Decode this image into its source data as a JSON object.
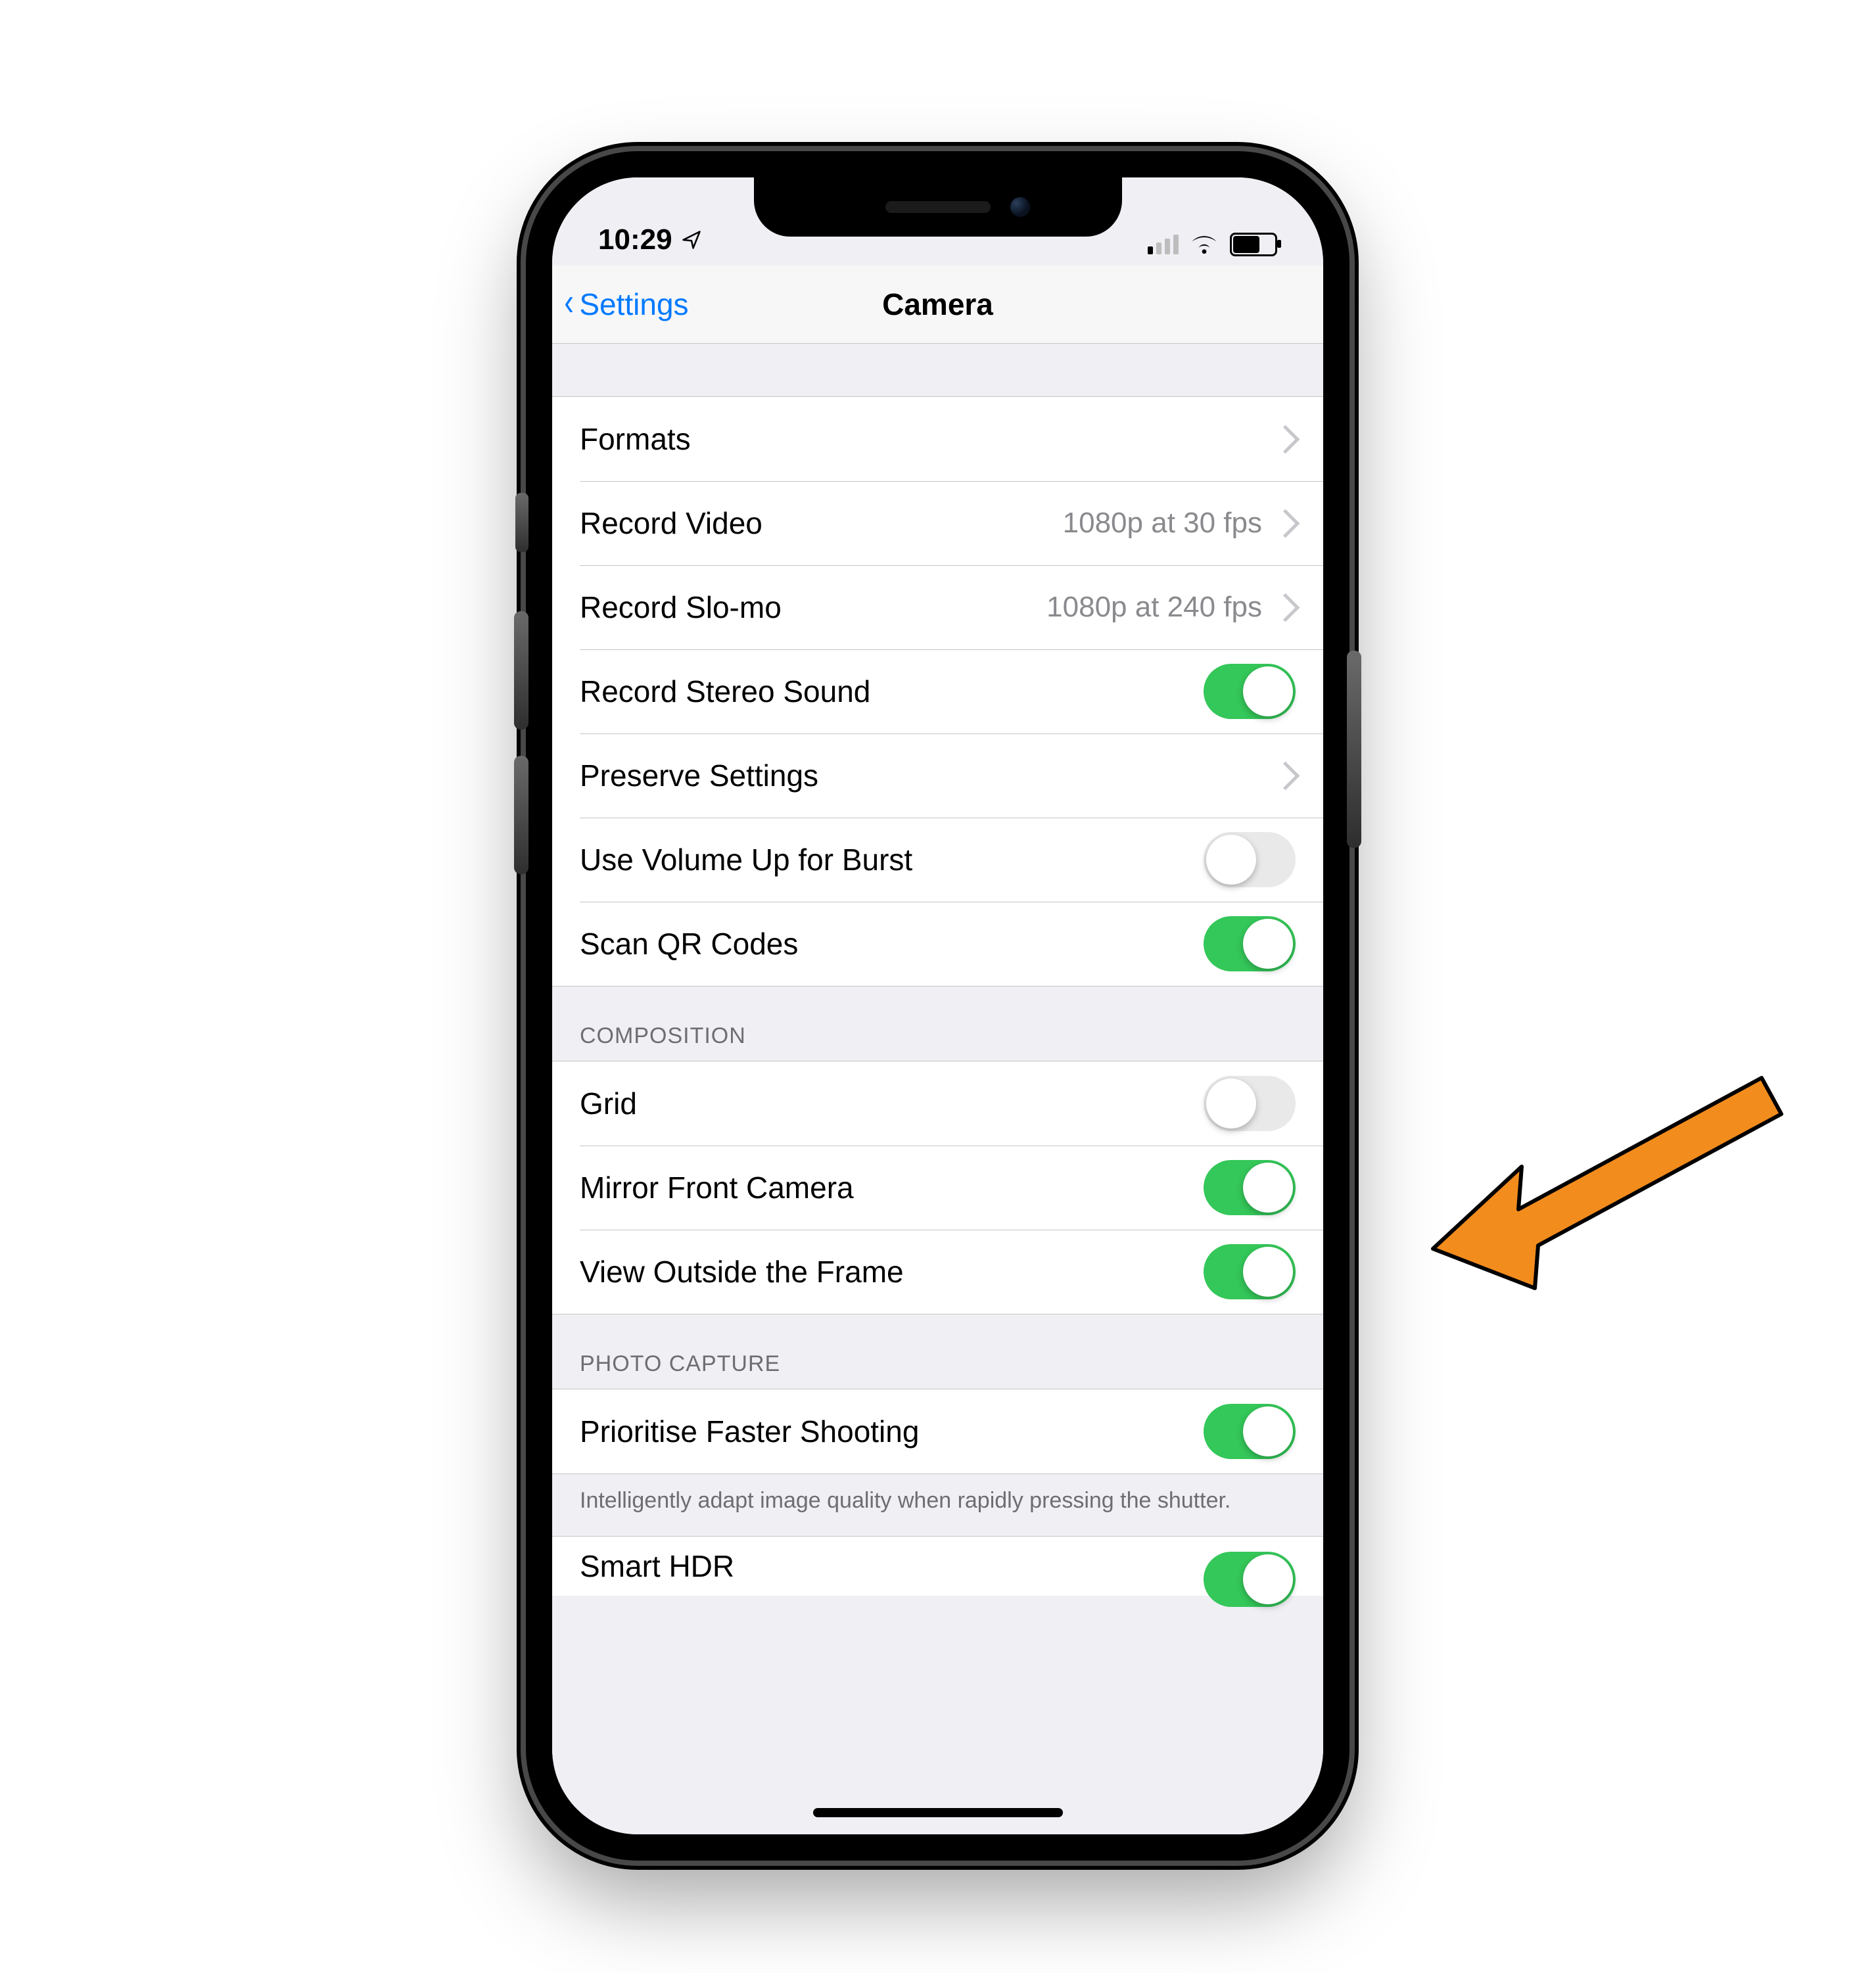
{
  "status": {
    "time": "10:29",
    "location_icon": "location-arrow-icon"
  },
  "nav": {
    "back_label": "Settings",
    "title": "Camera"
  },
  "groups": {
    "general": {
      "rows": {
        "formats": {
          "label": "Formats"
        },
        "record_video": {
          "label": "Record Video",
          "detail": "1080p at 30 fps"
        },
        "record_slomo": {
          "label": "Record Slo-mo",
          "detail": "1080p at 240 fps"
        },
        "stereo_sound": {
          "label": "Record Stereo Sound",
          "on": true
        },
        "preserve_settings": {
          "label": "Preserve Settings"
        },
        "vol_up_burst": {
          "label": "Use Volume Up for Burst",
          "on": false
        },
        "scan_qr": {
          "label": "Scan QR Codes",
          "on": true
        }
      }
    },
    "composition": {
      "header": "COMPOSITION",
      "rows": {
        "grid": {
          "label": "Grid",
          "on": false
        },
        "mirror_front": {
          "label": "Mirror Front Camera",
          "on": true
        },
        "outside_frame": {
          "label": "View Outside the Frame",
          "on": true
        }
      }
    },
    "photo_capture": {
      "header": "PHOTO CAPTURE",
      "rows": {
        "fast_shoot": {
          "label": "Prioritise Faster Shooting",
          "on": true
        }
      },
      "footer": "Intelligently adapt image quality when rapidly pressing the shutter."
    },
    "cutoff": {
      "label": "Smart HDR",
      "on": true
    }
  },
  "annotation": {
    "arrow_color": "#f28c1d",
    "arrow_stroke": "#000000"
  }
}
